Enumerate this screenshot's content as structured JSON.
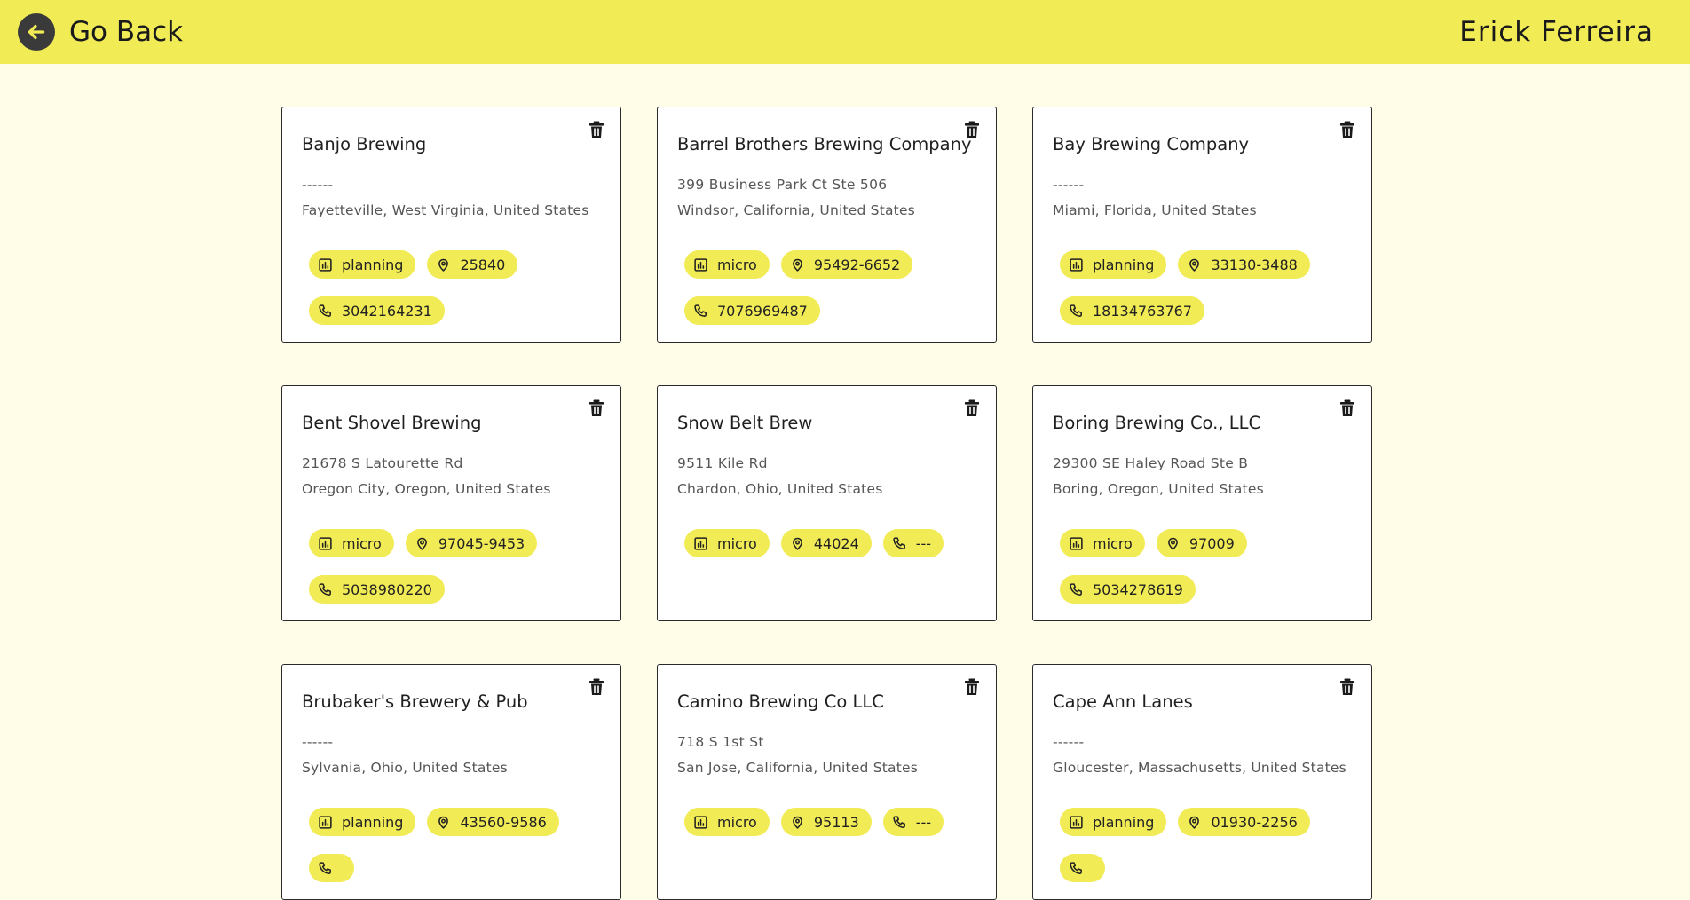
{
  "header": {
    "back_label": "Go Back",
    "user_name": "Erick Ferreira"
  },
  "colors": {
    "accent": "#f1eb56",
    "background": "#fffde8",
    "card_border": "#2a2a2a"
  },
  "breweries": [
    {
      "name": "Banjo Brewing",
      "street": "------",
      "location": "Fayetteville, West Virginia, United States",
      "type": "planning",
      "postal": "25840",
      "phone": "3042164231"
    },
    {
      "name": "Barrel Brothers Brewing Company",
      "street": "399 Business Park Ct Ste 506",
      "location": "Windsor, California, United States",
      "type": "micro",
      "postal": "95492-6652",
      "phone": "7076969487"
    },
    {
      "name": "Bay Brewing Company",
      "street": "------",
      "location": "Miami, Florida, United States",
      "type": "planning",
      "postal": "33130-3488",
      "phone": "18134763767"
    },
    {
      "name": "Bent Shovel Brewing",
      "street": "21678 S Latourette Rd",
      "location": "Oregon City, Oregon, United States",
      "type": "micro",
      "postal": "97045-9453",
      "phone": "5038980220"
    },
    {
      "name": "Snow Belt Brew",
      "street": "9511 Kile Rd",
      "location": "Chardon, Ohio, United States",
      "type": "micro",
      "postal": "44024",
      "phone": "---"
    },
    {
      "name": "Boring Brewing Co., LLC",
      "street": "29300 SE Haley Road Ste B",
      "location": "Boring, Oregon, United States",
      "type": "micro",
      "postal": "97009",
      "phone": "5034278619"
    },
    {
      "name": "Brubaker's Brewery & Pub",
      "street": "------",
      "location": "Sylvania, Ohio, United States",
      "type": "planning",
      "postal": "43560-9586",
      "phone": ""
    },
    {
      "name": "Camino Brewing Co LLC",
      "street": "718 S 1st St",
      "location": "San Jose, California, United States",
      "type": "micro",
      "postal": "95113",
      "phone": "---"
    },
    {
      "name": "Cape Ann Lanes",
      "street": "------",
      "location": "Gloucester, Massachusetts, United States",
      "type": "planning",
      "postal": "01930-2256",
      "phone": ""
    }
  ],
  "icons": {
    "back": "arrow-left-icon",
    "delete": "trash-icon",
    "type": "bar-chart-icon",
    "postal": "map-pin-icon",
    "phone": "phone-icon"
  }
}
